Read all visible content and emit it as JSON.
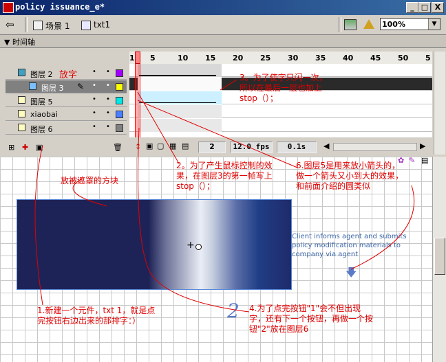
{
  "window": {
    "title": "policy issuance_e*",
    "min": "_",
    "max": "□",
    "close": "X"
  },
  "scenebar": {
    "scene": "场景 1",
    "symbol": "txt1",
    "zoom": "100%"
  },
  "timeline": {
    "label": "▼ 时间轴",
    "ruler": [
      "1",
      "5",
      "10",
      "15",
      "20",
      "25",
      "30",
      "35",
      "40",
      "45",
      "50",
      "5"
    ],
    "status": {
      "frame": "2",
      "fps": "12.0 fps",
      "time": "0.1s"
    }
  },
  "layers": [
    {
      "name": "图层 2",
      "tag": "放字",
      "color": "#a000ff"
    },
    {
      "name": "图层 3",
      "color": "#ffff00"
    },
    {
      "name": "图层 5",
      "color": "#00e8e8"
    },
    {
      "name": "xiaobai",
      "color": "#4a80ff"
    },
    {
      "name": "图层 6",
      "color": "#808080"
    }
  ],
  "stage": {
    "info_text": "Client informs agent and submits policy modification materials to company via agent",
    "button_two": "2"
  },
  "annotations": {
    "a1": "1.新建一个元件，txt 1，就是点完按钮右边出来的那排字：）",
    "a2": "2。为了产生鼠标控制的效果，在图层3的第一帧写上stop（）；",
    "a3": "3。为了使字只闪一次，所以在最后一层也加上stop（）；",
    "a4": "4.为了点完按钮\"1\"会不但出现字，还有下一个按钮，再做一个按钮\"2\"放在图层6",
    "a5": "放被遮罩的方块",
    "a6": "6.图层5是用来放小箭头的，做一个箭头又小到大的效果，和前面介绍的圆类似"
  }
}
